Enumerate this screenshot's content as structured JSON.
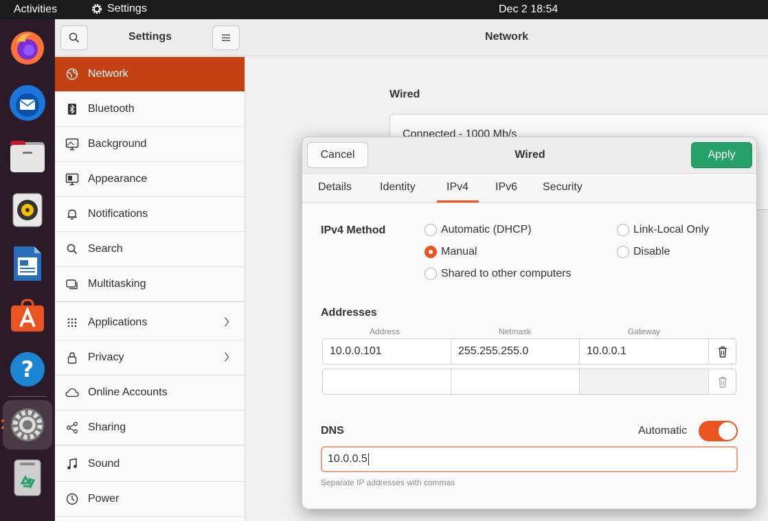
{
  "topbar": {
    "activities": "Activities",
    "app_name": "Settings",
    "clock": "Dec 2  18:54"
  },
  "dock": {
    "apps": [
      "firefox-icon",
      "thunderbird-icon",
      "files-icon",
      "rhythmbox-icon",
      "libreoffice-writer-icon",
      "app-center-icon",
      "help-icon",
      "settings-icon",
      "trash-icon"
    ]
  },
  "sidebar": {
    "title": "Settings",
    "items": [
      {
        "label": "Network",
        "icon": "network-icon"
      },
      {
        "label": "Bluetooth",
        "icon": "bluetooth-icon"
      },
      {
        "label": "Background",
        "icon": "background-icon"
      },
      {
        "label": "Appearance",
        "icon": "appearance-icon"
      },
      {
        "label": "Notifications",
        "icon": "bell-icon"
      },
      {
        "label": "Search",
        "icon": "search-icon"
      },
      {
        "label": "Multitasking",
        "icon": "multitasking-icon"
      },
      {
        "label": "Applications",
        "icon": "grid-icon"
      },
      {
        "label": "Privacy",
        "icon": "lock-icon"
      },
      {
        "label": "Online Accounts",
        "icon": "cloud-icon"
      },
      {
        "label": "Sharing",
        "icon": "share-icon"
      },
      {
        "label": "Sound",
        "icon": "music-note-icon"
      },
      {
        "label": "Power",
        "icon": "power-icon"
      }
    ]
  },
  "main": {
    "title": "Network",
    "wired_heading": "Wired",
    "wired_status": "Connected - 1000 Mb/s"
  },
  "dialog": {
    "title": "Wired",
    "cancel_label": "Cancel",
    "apply_label": "Apply",
    "tabs": [
      "Details",
      "Identity",
      "IPv4",
      "IPv6",
      "Security"
    ],
    "active_tab": "IPv4",
    "ipv4_method_label": "IPv4 Method",
    "methods": {
      "automatic": "Automatic (DHCP)",
      "manual": "Manual",
      "shared": "Shared to other computers",
      "link_local": "Link-Local Only",
      "disable": "Disable"
    },
    "selected_method": "Manual",
    "addresses_label": "Addresses",
    "columns": [
      "Address",
      "Netmask",
      "Gateway"
    ],
    "rows": [
      {
        "address": "10.0.0.101",
        "netmask": "255.255.255.0",
        "gateway": "10.0.0.1"
      },
      {
        "address": "",
        "netmask": "",
        "gateway": ""
      }
    ],
    "dns_label": "DNS",
    "dns_automatic_label": "Automatic",
    "dns_automatic_on": true,
    "dns_value": "10.0.0.5",
    "dns_help": "Separate IP addresses with commas"
  },
  "colors": {
    "accent": "#e95420",
    "sidebar_active": "#c34113",
    "apply": "#26a269"
  }
}
